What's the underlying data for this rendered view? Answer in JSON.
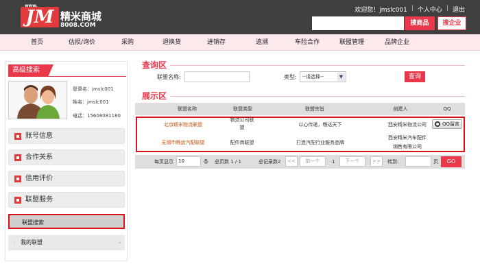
{
  "header": {
    "logo_www": "www.",
    "logo_mark": "JM",
    "logo_name": "精米商城",
    "logo_url": "8008.COM",
    "welcome": "欢迎您！jmslc001",
    "personal_center": "个人中心",
    "logout": "退出",
    "search_product_btn": "搜商品",
    "search_company_btn": "搜企业"
  },
  "nav": {
    "items": [
      "首页",
      "估损/询价",
      "采购",
      "退换货",
      "进销存",
      "追溯",
      "车险合作",
      "联盟管理",
      "品牌企业"
    ]
  },
  "sidebar": {
    "title": "高级搜索",
    "login_name": "登录名：jmslc001",
    "full_name": "姓名：jmslc001",
    "phone": "电话：15608081180",
    "menu": [
      "账号信息",
      "合作关系",
      "信用评价",
      "联盟服务"
    ],
    "sub_active": "联盟搜索",
    "sub_item": "我的联盟",
    "bullet": "·",
    "chevron": "›"
  },
  "query": {
    "title": "查询区",
    "name_label": "联盟名称:",
    "type_label": "类型:",
    "type_selected": "--请选择--",
    "submit": "查询"
  },
  "display": {
    "title": "展示区",
    "columns": [
      "联盟名称",
      "联盟类型",
      "联盟宗旨",
      "创建人",
      "QQ"
    ],
    "rows": [
      {
        "name": "北京精米物流联盟",
        "type_l1": "物流公司联",
        "type_l2": "盟",
        "purpose": "以心传递，畅达天下",
        "creator_l1": "西安精米物流公司",
        "creator_l2": "",
        "qq": "QQ留言"
      },
      {
        "name": "无锡市畅运汽配联盟",
        "type_l1": "配件商联盟",
        "type_l2": "",
        "purpose": "打造汽配行业服务品牌",
        "creator_l1": "西安精米汽车配件",
        "creator_l2": "销售有限公司",
        "qq": ""
      }
    ]
  },
  "pager": {
    "per_page_label": "每页显示",
    "per_page_value": "10",
    "unit": "条",
    "total_pages": "总页数 1 / 1",
    "total_records": "总记录数2",
    "first": "<<",
    "prev": "前一个",
    "current": "1",
    "next": "下一个",
    "last": ">>",
    "goto_label": "转到:",
    "page_unit": "页",
    "go": "GO"
  },
  "colors": {
    "accent": "#e8384a",
    "highlight_border": "#d9111c",
    "header_bg": "#3f3f3f",
    "nav_bg": "#fce9ec"
  }
}
